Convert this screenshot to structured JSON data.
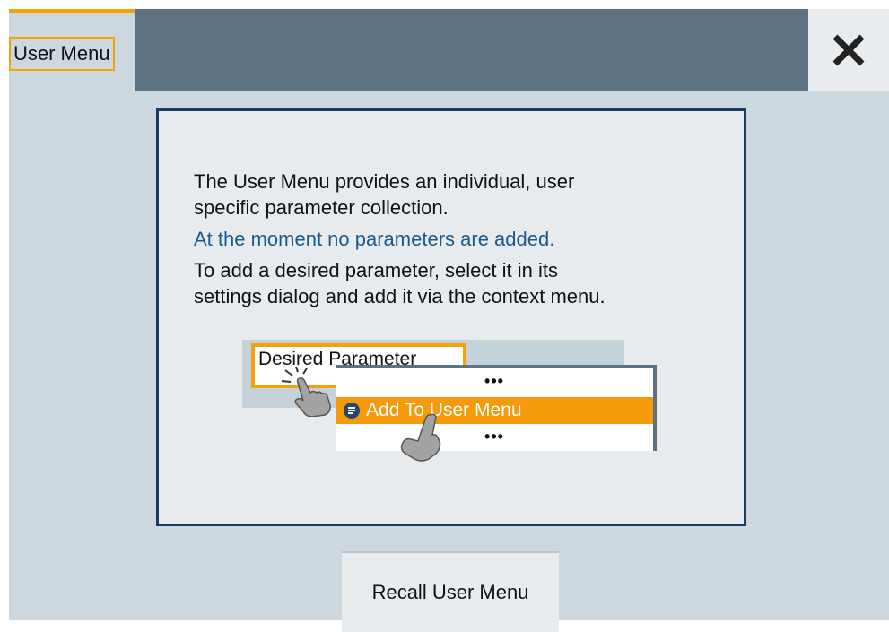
{
  "tab": {
    "label": "User Menu"
  },
  "header": {
    "close_icon": "close-icon"
  },
  "info": {
    "line1": "The User Menu provides an individual, user",
    "line2": "specific parameter collection.",
    "notice": "At the moment no parameters are added.",
    "line3": "To add a desired parameter, select it in its",
    "line4": "settings dialog and add it via the context menu."
  },
  "illustration": {
    "parameter_label": "Desired Parameter",
    "menu_dots_top": "•••",
    "menu_item": "Add To User Menu",
    "menu_dots_bottom": "•••"
  },
  "footer": {
    "recall_label": "Recall User Menu"
  },
  "colors": {
    "accent": "#f5a20a",
    "titlebar": "#5e7382",
    "panel": "#cdd8de",
    "notice_text": "#1a5a8f",
    "box_border": "#163c5f"
  }
}
